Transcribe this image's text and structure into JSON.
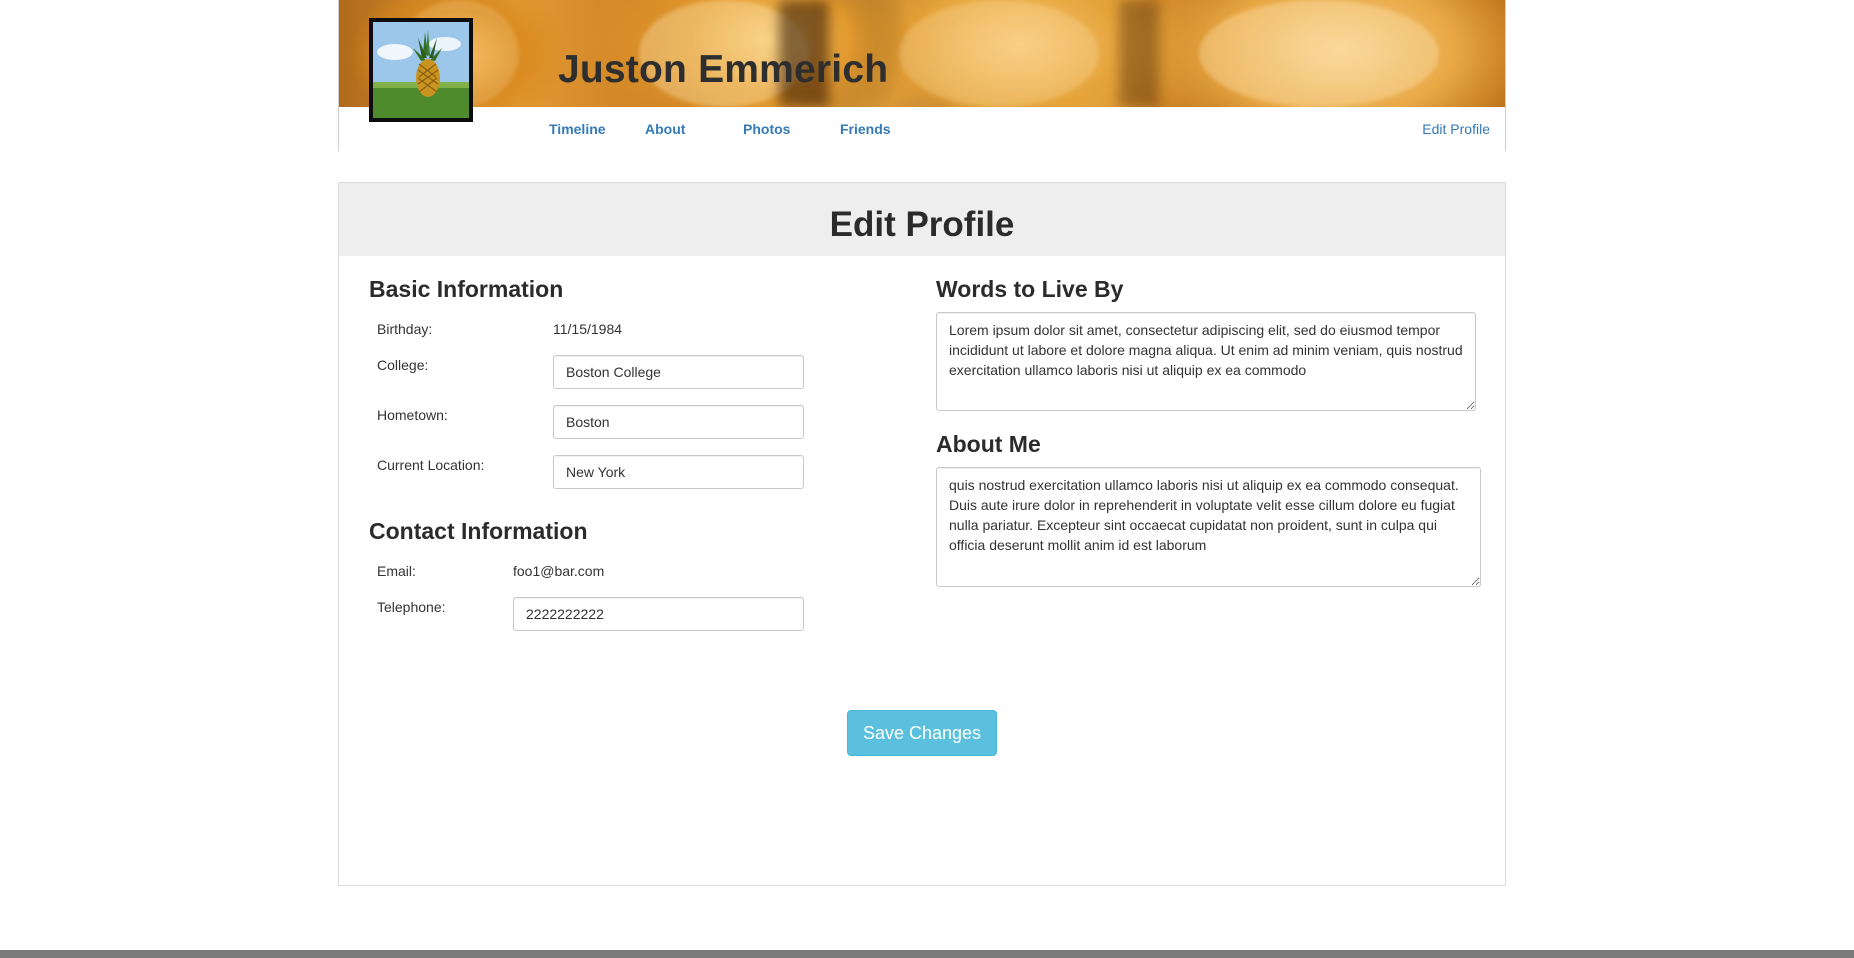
{
  "header": {
    "profile_name": "Juston Emmerich",
    "avatar_icon": "pineapple-photo",
    "nav": {
      "timeline": "Timeline",
      "about": "About",
      "photos": "Photos",
      "friends": "Friends",
      "edit_profile": "Edit Profile"
    }
  },
  "edit_profile": {
    "title": "Edit Profile",
    "basic_info": {
      "heading": "Basic Information",
      "birthday_label": "Birthday:",
      "birthday_value": "11/15/1984",
      "college_label": "College:",
      "college_value": "Boston College",
      "hometown_label": "Hometown:",
      "hometown_value": "Boston",
      "location_label": "Current Location:",
      "location_value": "New York"
    },
    "contact_info": {
      "heading": "Contact Information",
      "email_label": "Email:",
      "email_value": "foo1@bar.com",
      "telephone_label": "Telephone:",
      "telephone_value": "2222222222"
    },
    "words_to_live_by": {
      "heading": "Words to Live By",
      "text": "Lorem ipsum dolor sit amet, consectetur adipiscing elit, sed do eiusmod tempor incididunt ut labore et dolore magna aliqua. Ut enim ad minim veniam, quis nostrud exercitation ullamco laboris nisi ut aliquip ex ea commodo"
    },
    "about_me": {
      "heading": "About Me",
      "text": "quis nostrud exercitation ullamco laboris nisi ut aliquip ex ea commodo consequat. Duis aute irure dolor in reprehenderit in voluptate velit esse cillum dolore eu fugiat nulla pariatur. Excepteur sint occaecat cupidatat non proident, sunt in culpa qui officia deserunt mollit anim id est laborum"
    },
    "save_button": "Save Changes"
  },
  "colors": {
    "link": "#337ab7",
    "save_button": "#5bc0de",
    "title_bar": "#eeeeee"
  }
}
